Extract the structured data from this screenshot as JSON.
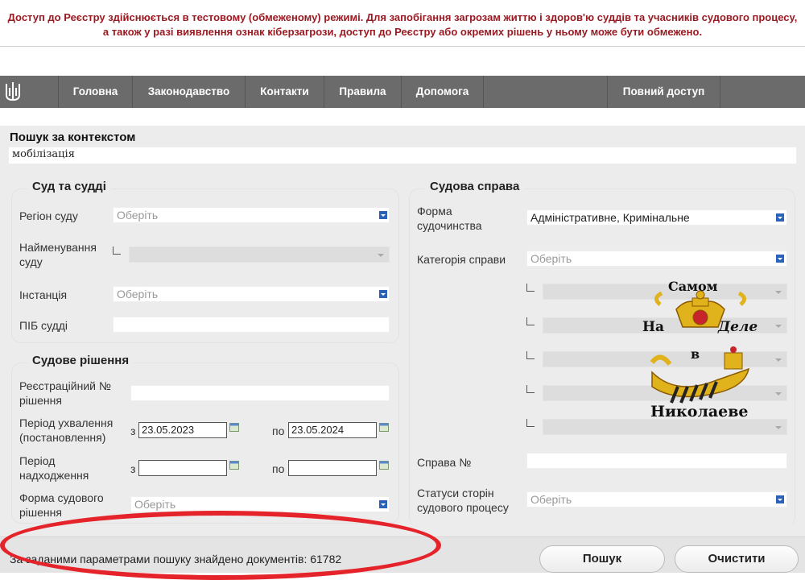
{
  "notice": "Доступ до Реєстру здійснюється в тестовому (обмеженому) режимі. Для запобігання загрозам життю і здоров'ю суддів та учасників судового процесу, а також у разі виявлення ознак кіберзагрози, доступ до Реєстру або окремих рішень у ньому може бути обмежено.",
  "nav": {
    "items": [
      "Головна",
      "Законодавство",
      "Контакти",
      "Правила",
      "Допомога",
      "Повний доступ"
    ]
  },
  "search": {
    "label": "Пошук за контекстом",
    "value": "мобілізація"
  },
  "court": {
    "title": "Суд та судді",
    "region_label": "Регіон суду",
    "region_value": "Оберіть",
    "name_label": "Найменування суду",
    "instance_label": "Інстанція",
    "instance_value": "Оберіть",
    "judge_label": "ПІБ судді"
  },
  "decision": {
    "title": "Судове рішення",
    "reg_label": "Реєстраційний № рішення",
    "adopted_label": "Період ухвалення (постановлення)",
    "adopted_from_prefix": "з",
    "adopted_from": "23.05.2023",
    "adopted_to_prefix": "по",
    "adopted_to": "23.05.2024",
    "received_label": "Період надходження",
    "received_from_prefix": "з",
    "received_to_prefix": "по",
    "form_label": "Форма судового рішення",
    "form_value": "Оберіть"
  },
  "case": {
    "title": "Судова справа",
    "form_label": "Форма судочинства",
    "form_value": "Адміністративне, Кримінальне",
    "category_label": "Категорія справи",
    "category_value": "Оберіть",
    "case_no_label": "Справа №",
    "status_label": "Статуси сторін судового процесу",
    "status_value": "Оберіть"
  },
  "stamp": {
    "line1": "Самом",
    "line2a": "На",
    "line2b": "Деле",
    "line3": "в",
    "line4": "Николаеве"
  },
  "footer": {
    "result": "За заданими параметрами пошуку знайдено документів: 61782",
    "search_btn": "Пошук",
    "clear_btn": "Очистити"
  },
  "colors": {
    "notice": "#9b1a22",
    "nav": "#6b6b6b",
    "accent": "#2a62b9",
    "mark": "#e5232a"
  }
}
